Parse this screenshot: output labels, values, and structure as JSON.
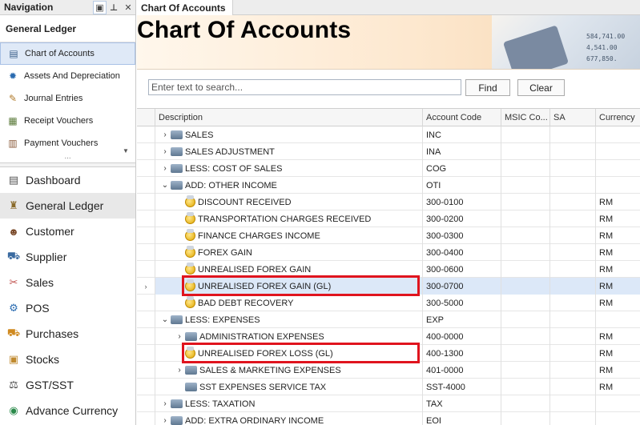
{
  "nav": {
    "header_title": "Navigation",
    "group_title": "General Ledger",
    "sub_items": [
      {
        "label": "Chart of Accounts",
        "icon": "chart-of-accounts-icon",
        "glyph": "▤",
        "color": "#3b5f8a",
        "selected": true
      },
      {
        "label": "Assets And Depreciation",
        "icon": "gear-icon",
        "glyph": "✹",
        "color": "#2a6bb0",
        "selected": false
      },
      {
        "label": "Journal Entries",
        "icon": "journal-icon",
        "glyph": "✎",
        "color": "#b07a2a",
        "selected": false
      },
      {
        "label": "Receipt Vouchers",
        "icon": "receipt-icon",
        "glyph": "▦",
        "color": "#5a7a3a",
        "selected": false
      },
      {
        "label": "Payment Vouchers",
        "icon": "payment-icon",
        "glyph": "▥",
        "color": "#8a5a3a",
        "selected": false
      }
    ],
    "ellipsis": "...",
    "main_items": [
      {
        "label": "Dashboard",
        "icon": "dashboard-icon",
        "glyph": "▤",
        "color": "#555",
        "selected": false
      },
      {
        "label": "General Ledger",
        "icon": "ledger-icon",
        "glyph": "♜",
        "color": "#8a6a2a",
        "selected": true
      },
      {
        "label": "Customer",
        "icon": "customer-icon",
        "glyph": "☻",
        "color": "#7a4a2a",
        "selected": false
      },
      {
        "label": "Supplier",
        "icon": "supplier-icon",
        "glyph": "⛟",
        "color": "#3a6aa0",
        "selected": false
      },
      {
        "label": "Sales",
        "icon": "sales-icon",
        "glyph": "✂",
        "color": "#c0504d",
        "selected": false
      },
      {
        "label": "POS",
        "icon": "pos-icon",
        "glyph": "⚙",
        "color": "#2a6bb0",
        "selected": false
      },
      {
        "label": "Purchases",
        "icon": "purchases-icon",
        "glyph": "⛟",
        "color": "#d08a20",
        "selected": false
      },
      {
        "label": "Stocks",
        "icon": "stocks-icon",
        "glyph": "▣",
        "color": "#c08a30",
        "selected": false
      },
      {
        "label": "GST/SST",
        "icon": "gst-icon",
        "glyph": "⚖",
        "color": "#444",
        "selected": false
      },
      {
        "label": "Advance Currency",
        "icon": "currency-icon",
        "glyph": "◉",
        "color": "#2a8a4a",
        "selected": false
      }
    ]
  },
  "tab": {
    "label": "Chart Of Accounts"
  },
  "page": {
    "title": "Chart Of Accounts"
  },
  "banner_numbers": [
    "584,741.00",
    "677,850.",
    "4,541.00"
  ],
  "search": {
    "placeholder": "Enter text to search...",
    "value": "",
    "find_label": "Find",
    "clear_label": "Clear"
  },
  "grid": {
    "headers": {
      "description": "Description",
      "account_code": "Account Code",
      "msic": "MSIC Co...",
      "sa": "SA",
      "currency": "Currency"
    },
    "rows": [
      {
        "level": 0,
        "expander": "›",
        "icon": "folder",
        "description": "SALES",
        "code": "INC",
        "currency": "",
        "focused": false,
        "highlight": false
      },
      {
        "level": 0,
        "expander": "›",
        "icon": "folder",
        "description": "SALES ADJUSTMENT",
        "code": "INA",
        "currency": "",
        "focused": false,
        "highlight": false
      },
      {
        "level": 0,
        "expander": "›",
        "icon": "folder",
        "description": "LESS: COST OF SALES",
        "code": "COG",
        "currency": "",
        "focused": false,
        "highlight": false
      },
      {
        "level": 0,
        "expander": "⌄",
        "icon": "folder",
        "description": "ADD: OTHER INCOME",
        "code": "OTI",
        "currency": "",
        "focused": false,
        "highlight": false
      },
      {
        "level": 1,
        "expander": "",
        "icon": "coin",
        "description": "DISCOUNT RECEIVED",
        "code": "300-0100",
        "currency": "RM",
        "focused": false,
        "highlight": false
      },
      {
        "level": 1,
        "expander": "",
        "icon": "coin",
        "description": "TRANSPORTATION CHARGES RECEIVED",
        "code": "300-0200",
        "currency": "RM",
        "focused": false,
        "highlight": false
      },
      {
        "level": 1,
        "expander": "",
        "icon": "coin",
        "description": "FINANCE CHARGES INCOME",
        "code": "300-0300",
        "currency": "RM",
        "focused": false,
        "highlight": false
      },
      {
        "level": 1,
        "expander": "",
        "icon": "coin",
        "description": "FOREX GAIN",
        "code": "300-0400",
        "currency": "RM",
        "focused": false,
        "highlight": false
      },
      {
        "level": 1,
        "expander": "",
        "icon": "coin",
        "description": "UNREALISED FOREX GAIN",
        "code": "300-0600",
        "currency": "RM",
        "focused": false,
        "highlight": false
      },
      {
        "level": 1,
        "expander": "",
        "icon": "coin",
        "description": "UNREALISED FOREX GAIN (GL)",
        "code": "300-0700",
        "currency": "RM",
        "focused": true,
        "highlight": true,
        "indicator": "›"
      },
      {
        "level": 1,
        "expander": "",
        "icon": "coin",
        "description": "BAD DEBT RECOVERY",
        "code": "300-5000",
        "currency": "RM",
        "focused": false,
        "highlight": false
      },
      {
        "level": 0,
        "expander": "⌄",
        "icon": "folder",
        "description": "LESS: EXPENSES",
        "code": "EXP",
        "currency": "",
        "focused": false,
        "highlight": false
      },
      {
        "level": 1,
        "expander": "›",
        "icon": "folder",
        "description": "ADMINISTRATION EXPENSES",
        "code": "400-0000",
        "currency": "RM",
        "focused": false,
        "highlight": false
      },
      {
        "level": 1,
        "expander": "",
        "icon": "coin",
        "description": "UNREALISED FOREX LOSS (GL)",
        "code": "400-1300",
        "currency": "RM",
        "focused": false,
        "highlight": true
      },
      {
        "level": 1,
        "expander": "›",
        "icon": "folder",
        "description": "SALES & MARKETING EXPENSES",
        "code": "401-0000",
        "currency": "RM",
        "focused": false,
        "highlight": false
      },
      {
        "level": 1,
        "expander": "",
        "icon": "folder",
        "description": "SST EXPENSES SERVICE TAX",
        "code": "SST-4000",
        "currency": "RM",
        "focused": false,
        "highlight": false
      },
      {
        "level": 0,
        "expander": "›",
        "icon": "folder",
        "description": "LESS: TAXATION",
        "code": "TAX",
        "currency": "",
        "focused": false,
        "highlight": false
      },
      {
        "level": 0,
        "expander": "›",
        "icon": "folder",
        "description": "ADD: EXTRA ORDINARY INCOME",
        "code": "EOI",
        "currency": "",
        "focused": false,
        "highlight": false
      }
    ]
  },
  "colors": {
    "highlight_border": "#e0141e",
    "selected_row": "#dce8f8",
    "selected_nav": "#dfe9f7"
  }
}
